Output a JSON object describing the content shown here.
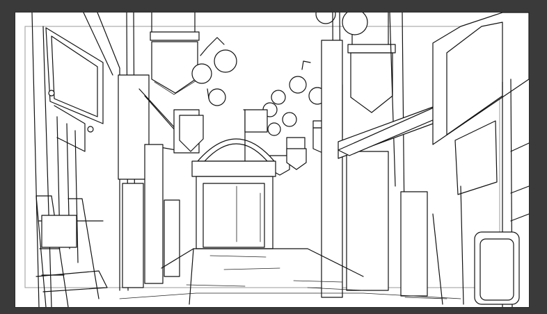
{
  "canvas": {
    "background": "#3a3a3a",
    "paper": "#ffffff",
    "guide_color": "#9a9a9a",
    "subject": "line-art-sketch"
  }
}
